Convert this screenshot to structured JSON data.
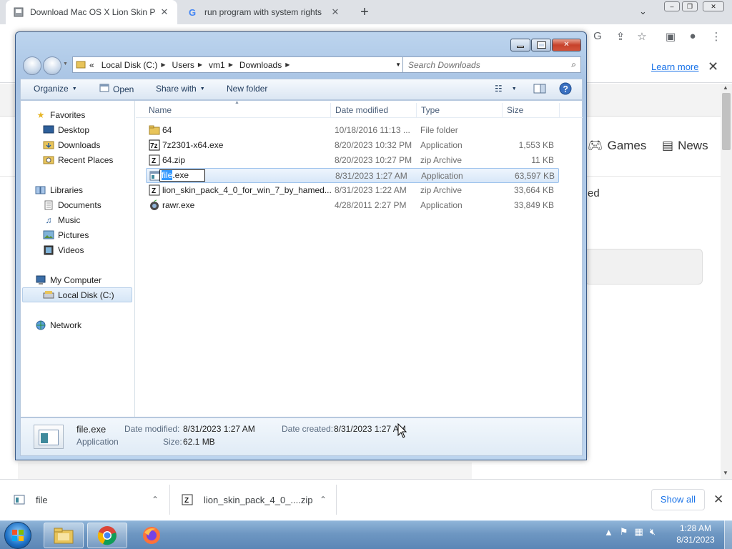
{
  "browser": {
    "tabs": [
      {
        "title": "Download Mac OS X Lion Skin Pa",
        "favicon": "page-icon",
        "active": true
      },
      {
        "title": "run program with system rights",
        "favicon": "google-g-icon",
        "active": false
      }
    ],
    "new_tab_label": "+",
    "infobar": {
      "learn_more": "Learn more"
    },
    "webpage": {
      "nav_games": "Games",
      "nav_news": "News",
      "fragment": "ed"
    }
  },
  "explorer": {
    "address": {
      "prefix": "«",
      "segments": [
        "Local Disk (C:)",
        "Users",
        "vm1",
        "Downloads"
      ]
    },
    "search_placeholder": "Search Downloads",
    "commands": {
      "organize": "Organize",
      "open": "Open",
      "share_with": "Share with",
      "new_folder": "New folder"
    },
    "nav": {
      "favorites": "Favorites",
      "desktop": "Desktop",
      "downloads": "Downloads",
      "recent_places": "Recent Places",
      "libraries": "Libraries",
      "documents": "Documents",
      "music": "Music",
      "pictures": "Pictures",
      "videos": "Videos",
      "my_computer": "My Computer",
      "local_disk": "Local Disk (C:)",
      "network": "Network"
    },
    "columns": {
      "name": "Name",
      "date": "Date modified",
      "type": "Type",
      "size": "Size"
    },
    "files": [
      {
        "name": "64",
        "date": "10/18/2016 11:13 ...",
        "type": "File folder",
        "size": "",
        "icon": "folder-icon"
      },
      {
        "name": "7z2301-x64.exe",
        "date": "8/20/2023 10:32 PM",
        "type": "Application",
        "size": "1,553 KB",
        "icon": "7zip-installer-icon"
      },
      {
        "name": "64.zip",
        "date": "8/20/2023 10:27 PM",
        "type": "zip Archive",
        "size": "11 KB",
        "icon": "zip-archive-icon"
      },
      {
        "name": "",
        "date": "8/31/2023 1:27 AM",
        "type": "Application",
        "size": "63,597 KB",
        "icon": "application-icon"
      },
      {
        "name": "lion_skin_pack_4_0_for_win_7_by_hamed...",
        "date": "8/31/2023 1:22 AM",
        "type": "zip Archive",
        "size": "33,664 KB",
        "icon": "zip-archive-icon"
      },
      {
        "name": "rawr.exe",
        "date": "4/28/2011 2:27 PM",
        "type": "Application",
        "size": "33,849 KB",
        "icon": "apple-logo-icon"
      }
    ],
    "rename": {
      "selected": "file",
      "rest": ".exe"
    },
    "details": {
      "filename": "file.exe",
      "kind": "Application",
      "date_modified_label": "Date modified:",
      "date_modified": "8/31/2023 1:27 AM",
      "date_created_label": "Date created:",
      "date_created": "8/31/2023 1:27 AM",
      "size_label": "Size:",
      "size": "62.1 MB"
    }
  },
  "downloads_shelf": {
    "items": [
      {
        "name": "file",
        "icon": "application-icon"
      },
      {
        "name": "lion_skin_pack_4_0_....zip",
        "icon": "zip-archive-icon"
      }
    ],
    "show_all": "Show all"
  },
  "taskbar": {
    "time": "1:28 AM",
    "date": "8/31/2023"
  },
  "colors": {
    "accent": "#1a73e8",
    "selection": "#3399ff",
    "window_frame": "#bcd4ee",
    "close_red": "#c7422b"
  }
}
